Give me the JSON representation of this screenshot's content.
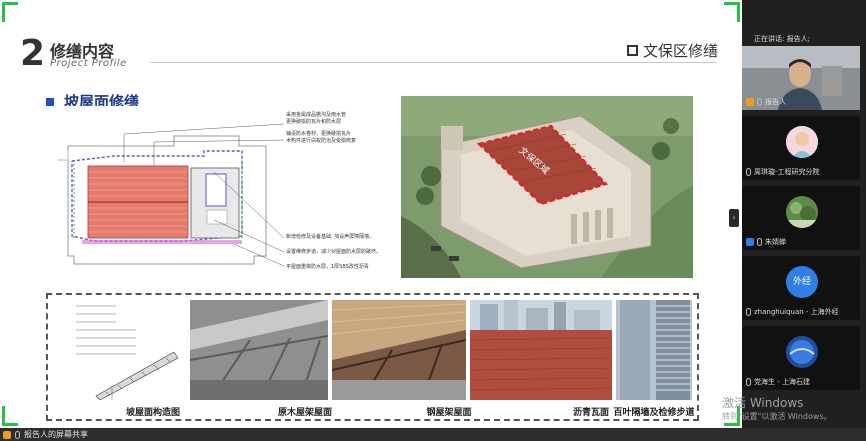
{
  "slide": {
    "section_number": "2",
    "section_title": "修缮内容",
    "section_subtitle": "Project Profile",
    "area_title": "文保区修缮",
    "sub_heading": "坡屋面修缮",
    "plan_annotations": [
      "采用金属成品檐沟及雨水管",
      "更换破损的瓦片和防水层",
      "铺设防水卷材，更换破损瓦片",
      "木构件进行白蚁防治及受损修复",
      "新增检修及设备基础, 加设声屏障隔墙。",
      "设置维修步道，减少对屋面防水层的破坏。",
      "平屋面重做防水层，1厚SBS改性沥青"
    ],
    "photo_label": "文保区域",
    "captions": [
      "坡屋面构造图",
      "原木屋架屋面",
      "钢屋架屋面",
      "沥青瓦面",
      "百叶隔墙及检修步道"
    ]
  },
  "meeting": {
    "speaking_label": "正在讲话: 报告人;",
    "participants": [
      {
        "name": "报告人"
      },
      {
        "name": "周琪璇-工程研究分院"
      },
      {
        "name": "朱婧蝉"
      },
      {
        "name": "zhanghuiquan - 上海外经",
        "avatar_text": "外经"
      },
      {
        "name": "党海生 - 上海石建"
      }
    ],
    "share_label": "报告人的屏幕共享"
  },
  "watermark": {
    "line1": "激活 Windows",
    "line2": "转到\"设置\"以激活 Windows。"
  },
  "colors": {
    "accent_green": "#2bbf4a",
    "heading_blue": "#1f3b8c",
    "avatar_blue": "#2f7fe6"
  }
}
